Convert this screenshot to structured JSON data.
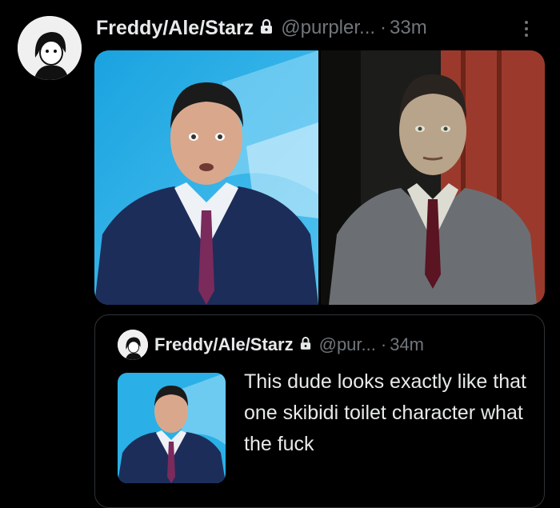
{
  "post": {
    "author_name": "Freddy/Ale/Starz",
    "handle": "@purpler...",
    "dot": "·",
    "time": "33m",
    "images": [
      {
        "description_icon": "news-anchor-photo"
      },
      {
        "description_icon": "gman-character-render"
      }
    ]
  },
  "quoted": {
    "author_name": "Freddy/Ale/Starz",
    "handle": "@pur...",
    "dot": "·",
    "time": "34m",
    "text": "This dude looks exactly like that one skibidi toilet character what the fuck"
  },
  "icons": {
    "lock": "lock-icon",
    "more": "more-vertical-icon"
  },
  "colors": {
    "background": "#000000",
    "text": "#e7e9ea",
    "muted": "#71767b",
    "border": "#2f3336"
  }
}
